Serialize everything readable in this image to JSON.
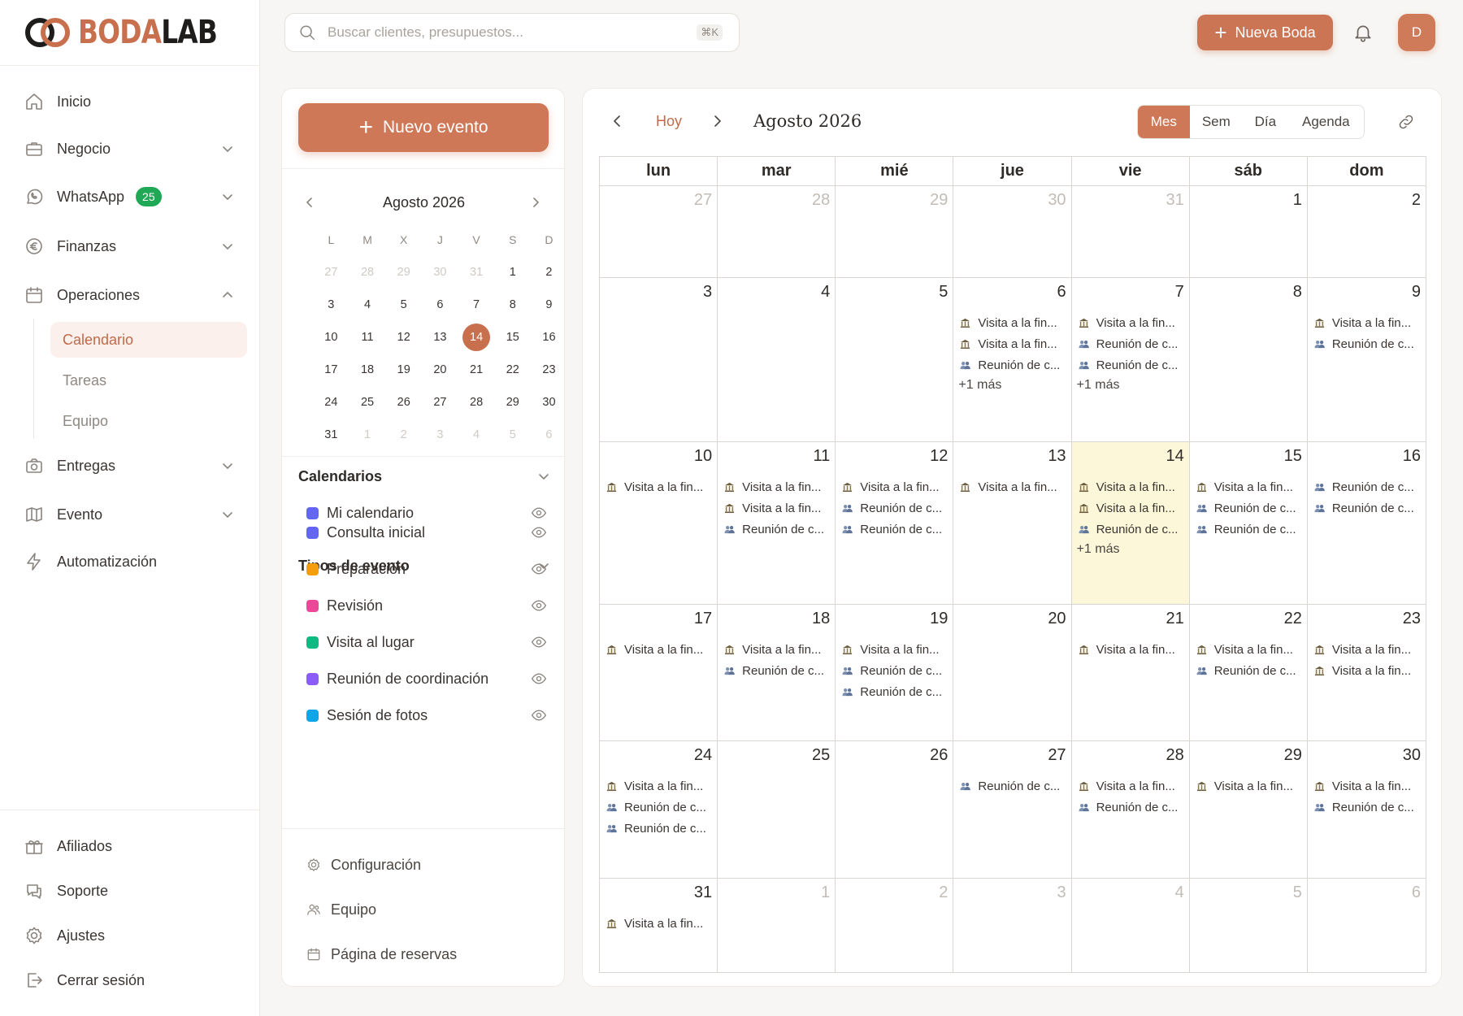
{
  "brand": {
    "word1": "BODA",
    "word2": "LAB"
  },
  "header": {
    "search_placeholder": "Buscar clientes, presupuestos...",
    "shortcut": "⌘K",
    "new_wedding": "Nueva Boda",
    "avatar_initial": "D"
  },
  "sidebar": {
    "nav": [
      {
        "label": "Inicio"
      },
      {
        "label": "Negocio"
      },
      {
        "label": "WhatsApp",
        "badge": "25"
      },
      {
        "label": "Finanzas"
      },
      {
        "label": "Operaciones"
      },
      {
        "label": "Entregas"
      },
      {
        "label": "Evento"
      },
      {
        "label": "Automatización"
      }
    ],
    "sub": [
      {
        "label": "Calendario"
      },
      {
        "label": "Tareas"
      },
      {
        "label": "Equipo"
      }
    ],
    "bottom": [
      {
        "label": "Afiliados"
      },
      {
        "label": "Soporte"
      },
      {
        "label": "Ajustes"
      },
      {
        "label": "Cerrar sesión"
      }
    ]
  },
  "left_panel": {
    "new_event": "Nuevo evento",
    "mini_title": "Agosto 2026",
    "weekdays": [
      "L",
      "M",
      "X",
      "J",
      "V",
      "S",
      "D"
    ],
    "calendars_title": "Calendarios",
    "calendars": [
      {
        "label": "Mi calendario",
        "color": "#6366f1"
      }
    ],
    "types_title": "Tipos de evento",
    "types": [
      {
        "label": "Consulta inicial",
        "color": "#6366f1"
      },
      {
        "label": "Preparación",
        "color": "#f59e0b"
      },
      {
        "label": "Revisión",
        "color": "#ec4899"
      },
      {
        "label": "Visita al lugar",
        "color": "#10b981"
      },
      {
        "label": "Reunión de coordinación",
        "color": "#8b5cf6"
      },
      {
        "label": "Sesión de fotos",
        "color": "#0ea5e9"
      }
    ],
    "footer": [
      {
        "label": "Configuración"
      },
      {
        "label": "Equipo"
      },
      {
        "label": "Página de reservas"
      }
    ]
  },
  "calendar": {
    "today_label": "Hoy",
    "title": "Agosto 2026",
    "views": [
      "Mes",
      "Sem",
      "Día",
      "Agenda"
    ],
    "active_view": "Mes",
    "weekdays": [
      "lun",
      "mar",
      "mié",
      "jue",
      "vie",
      "sáb",
      "dom"
    ],
    "today": 14,
    "visit_text": "Visita a la fin...",
    "meeting_text": "Reunión de c...",
    "weeks": [
      [
        {
          "d": "27",
          "dim": true,
          "ev": []
        },
        {
          "d": "28",
          "dim": true,
          "ev": []
        },
        {
          "d": "29",
          "dim": true,
          "ev": []
        },
        {
          "d": "30",
          "dim": true,
          "ev": []
        },
        {
          "d": "31",
          "dim": true,
          "ev": []
        },
        {
          "d": "1",
          "ev": []
        },
        {
          "d": "2",
          "ev": []
        }
      ],
      [
        {
          "d": "3",
          "ev": []
        },
        {
          "d": "4",
          "ev": []
        },
        {
          "d": "5",
          "ev": []
        },
        {
          "d": "6",
          "ev": [
            "v",
            "v",
            "r"
          ],
          "more": "+1 más"
        },
        {
          "d": "7",
          "ev": [
            "v",
            "r",
            "r"
          ],
          "more": "+1 más"
        },
        {
          "d": "8",
          "ev": []
        },
        {
          "d": "9",
          "ev": [
            "v",
            "r"
          ]
        }
      ],
      [
        {
          "d": "10",
          "ev": [
            "v"
          ]
        },
        {
          "d": "11",
          "ev": [
            "v",
            "v",
            "r"
          ]
        },
        {
          "d": "12",
          "ev": [
            "v",
            "r",
            "r"
          ]
        },
        {
          "d": "13",
          "ev": [
            "v"
          ]
        },
        {
          "d": "14",
          "ev": [
            "v",
            "v",
            "r"
          ],
          "more": "+1 más",
          "today": true
        },
        {
          "d": "15",
          "ev": [
            "v",
            "r",
            "r"
          ]
        },
        {
          "d": "16",
          "ev": [
            "r",
            "r"
          ]
        }
      ],
      [
        {
          "d": "17",
          "ev": [
            "v"
          ]
        },
        {
          "d": "18",
          "ev": [
            "v",
            "r"
          ]
        },
        {
          "d": "19",
          "ev": [
            "v",
            "r",
            "r"
          ]
        },
        {
          "d": "20",
          "ev": []
        },
        {
          "d": "21",
          "ev": [
            "v"
          ]
        },
        {
          "d": "22",
          "ev": [
            "v",
            "r"
          ]
        },
        {
          "d": "23",
          "ev": [
            "v",
            "v"
          ]
        }
      ],
      [
        {
          "d": "24",
          "ev": [
            "v",
            "r",
            "r"
          ]
        },
        {
          "d": "25",
          "ev": []
        },
        {
          "d": "26",
          "ev": []
        },
        {
          "d": "27",
          "ev": [
            "r"
          ]
        },
        {
          "d": "28",
          "ev": [
            "v",
            "r"
          ]
        },
        {
          "d": "29",
          "ev": [
            "v"
          ]
        },
        {
          "d": "30",
          "ev": [
            "v",
            "r"
          ]
        }
      ],
      [
        {
          "d": "31",
          "ev": [
            "v"
          ]
        },
        {
          "d": "1",
          "dim": true,
          "ev": []
        },
        {
          "d": "2",
          "dim": true,
          "ev": []
        },
        {
          "d": "3",
          "dim": true,
          "ev": []
        },
        {
          "d": "4",
          "dim": true,
          "ev": []
        },
        {
          "d": "5",
          "dim": true,
          "ev": []
        },
        {
          "d": "6",
          "dim": true,
          "ev": []
        }
      ]
    ]
  },
  "mini_calendar": {
    "days": [
      [
        "27",
        "28",
        "29",
        "30",
        "31",
        "1",
        "2"
      ],
      [
        "3",
        "4",
        "5",
        "6",
        "7",
        "8",
        "9"
      ],
      [
        "10",
        "11",
        "12",
        "13",
        "14",
        "15",
        "16"
      ],
      [
        "17",
        "18",
        "19",
        "20",
        "21",
        "22",
        "23"
      ],
      [
        "24",
        "25",
        "26",
        "27",
        "28",
        "29",
        "30"
      ],
      [
        "31",
        "1",
        "2",
        "3",
        "4",
        "5",
        "6"
      ]
    ],
    "selected": "14"
  }
}
